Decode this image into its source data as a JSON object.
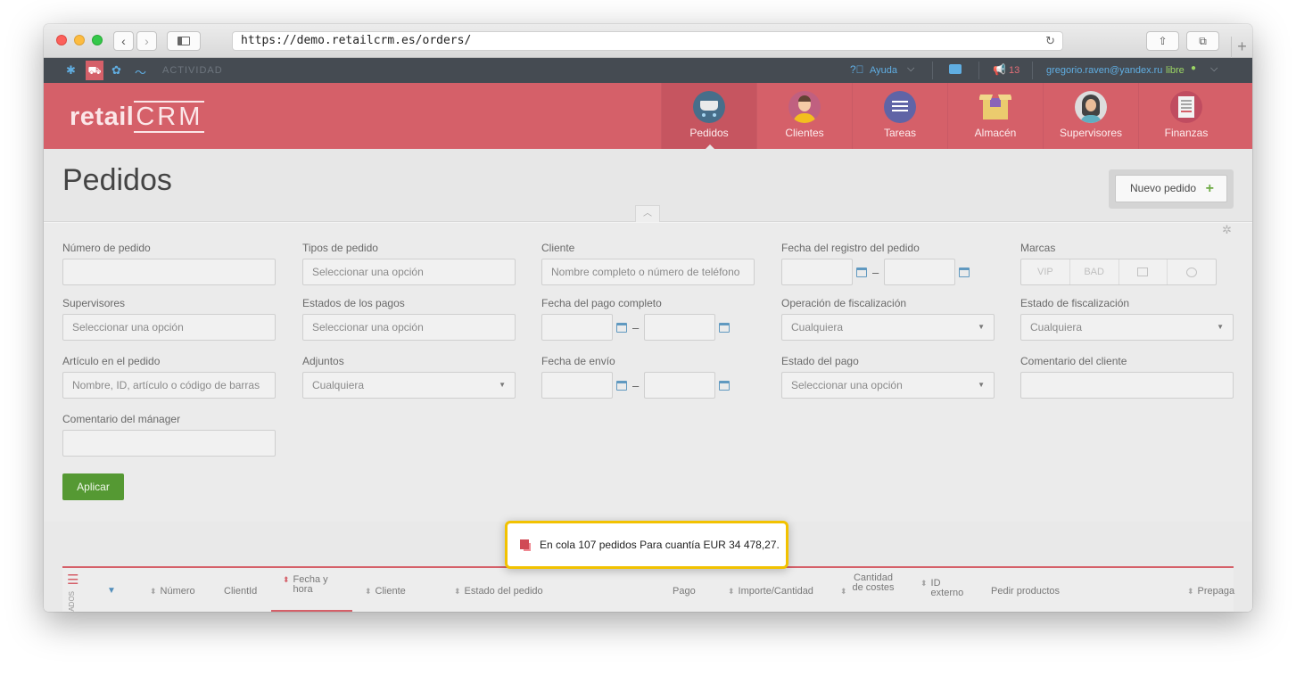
{
  "browser": {
    "url": "https://demo.retailcrm.es/orders/"
  },
  "topbar": {
    "activity_label": "ACTIVIDAD",
    "help_label": "Ayuda",
    "notifications_count": "13",
    "user_email": "gregorio.raven@yandex.ru",
    "user_status": "libre"
  },
  "brand": {
    "logo_prefix": "retail",
    "logo_suffix": "CRM"
  },
  "nav": {
    "items": [
      {
        "label": "Pedidos",
        "icon": "cart-icon",
        "active": true
      },
      {
        "label": "Clientes",
        "icon": "customer-icon"
      },
      {
        "label": "Tareas",
        "icon": "tasks-icon"
      },
      {
        "label": "Almacén",
        "icon": "warehouse-icon"
      },
      {
        "label": "Supervisores",
        "icon": "supervisor-icon"
      },
      {
        "label": "Finanzas",
        "icon": "finance-icon"
      }
    ]
  },
  "page": {
    "title": "Pedidos",
    "new_order_label": "Nuevo pedido"
  },
  "filters": {
    "order_number": {
      "label": "Número de pedido",
      "value": ""
    },
    "order_types": {
      "label": "Tipos de pedido",
      "placeholder": "Seleccionar una opción"
    },
    "client": {
      "label": "Cliente",
      "placeholder": "Nombre completo o número de teléfono"
    },
    "reg_date": {
      "label": "Fecha del registro del pedido"
    },
    "brands": {
      "label": "Marcas",
      "options": [
        "VIP",
        "BAD"
      ]
    },
    "supervisors": {
      "label": "Supervisores",
      "placeholder": "Seleccionar una opción"
    },
    "payment_states": {
      "label": "Estados de los pagos",
      "placeholder": "Seleccionar una opción"
    },
    "full_payment_date": {
      "label": "Fecha del pago completo"
    },
    "fiscal_operation": {
      "label": "Operación de fiscalización",
      "value": "Cualquiera"
    },
    "fiscal_state": {
      "label": "Estado de fiscalización",
      "value": "Cualquiera"
    },
    "order_item": {
      "label": "Artículo en el pedido",
      "placeholder": "Nombre, ID, artículo o código de barras"
    },
    "attachments": {
      "label": "Adjuntos",
      "value": "Cualquiera"
    },
    "shipping_date": {
      "label": "Fecha de envío"
    },
    "payment_state": {
      "label": "Estado del pago",
      "placeholder": "Seleccionar una opción"
    },
    "client_comment": {
      "label": "Comentario del cliente",
      "value": ""
    },
    "manager_comment": {
      "label": "Comentario del mánager",
      "value": ""
    },
    "apply_label": "Aplicar"
  },
  "table": {
    "side_tab": "ADOS",
    "columns": {
      "number": "Número",
      "client_id": "ClientId",
      "date_time": "Fecha y hora",
      "client": "Cliente",
      "status": "Estado del pedido",
      "payment": "Pago",
      "amount": "Importe/Cantidad",
      "costs": "Cantidad de costes",
      "external_id": "ID externo",
      "order_products": "Pedir productos",
      "prepay": "Prepaga"
    }
  },
  "toast": {
    "message": "En cola 107 pedidos Para cuantía EUR 34 478,27."
  },
  "colors": {
    "brand_red": "#d04a55",
    "apply_green": "#3e8b17",
    "toast_border": "#f2c200"
  }
}
